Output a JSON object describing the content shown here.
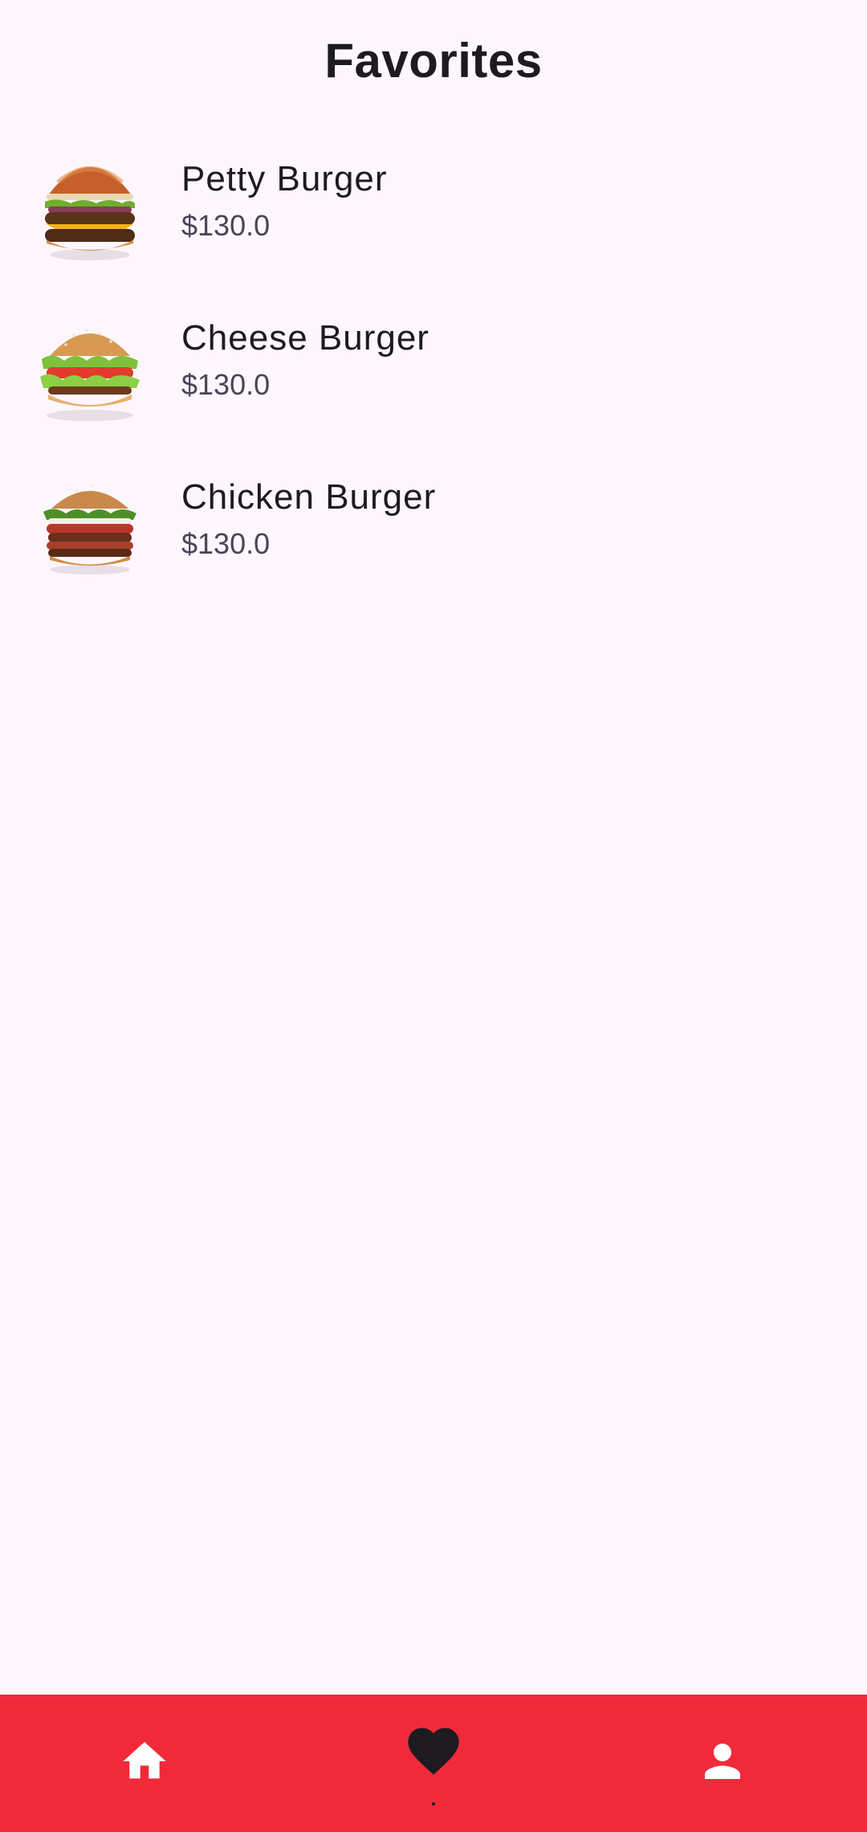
{
  "header": {
    "title": "Favorites"
  },
  "favorites": [
    {
      "name": "Petty Burger",
      "price": "$130.0",
      "image": "burger-double-patty-image"
    },
    {
      "name": "Cheese Burger",
      "price": "$130.0",
      "image": "burger-cheese-lettuce-image"
    },
    {
      "name": "Chicken Burger",
      "price": "$130.0",
      "image": "burger-chicken-image"
    }
  ],
  "bottom_nav": {
    "items": [
      {
        "icon": "home-icon",
        "selected": false
      },
      {
        "icon": "heart-icon",
        "selected": true
      },
      {
        "icon": "person-icon",
        "selected": false
      }
    ],
    "background": "#f12a3b",
    "icon_color_inactive": "#ffffff",
    "icon_color_active": "#1d1b20"
  },
  "colors": {
    "page_background": "#fdf7fd",
    "text_primary": "#1d1b20",
    "text_secondary": "#4a4458"
  }
}
